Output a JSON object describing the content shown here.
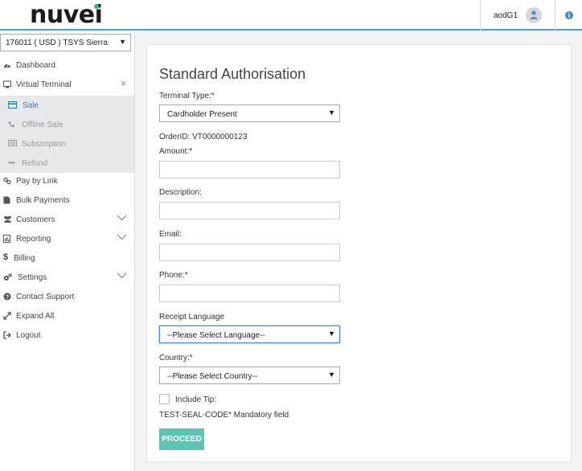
{
  "header": {
    "brand": "nuvei",
    "user_name": "aodG1"
  },
  "sidebar": {
    "merchant": "176011 ( USD ) TSYS Sierra",
    "items": [
      {
        "label": "Dashboard",
        "icon": "dashboard-icon"
      },
      {
        "label": "Virtual Terminal",
        "icon": "terminal-icon"
      },
      {
        "label": "Pay by Link",
        "icon": "link-icon"
      },
      {
        "label": "Bulk Payments",
        "icon": "document-icon"
      },
      {
        "label": "Customers",
        "icon": "users-icon"
      },
      {
        "label": "Reporting",
        "icon": "report-icon"
      },
      {
        "label": "Billing",
        "icon": "dollar-icon"
      },
      {
        "label": "Settings",
        "icon": "gears-icon"
      },
      {
        "label": "Contact Support",
        "icon": "question-icon"
      },
      {
        "label": "Expand All",
        "icon": "expand-icon"
      },
      {
        "label": "Logout",
        "icon": "logout-icon"
      }
    ],
    "subitems": [
      {
        "label": "Sale",
        "icon": "card-icon"
      },
      {
        "label": "Offline Sale",
        "icon": "phone-icon"
      },
      {
        "label": "Subscription",
        "icon": "keyboard-icon"
      },
      {
        "label": "Refund",
        "icon": "minus-icon"
      }
    ]
  },
  "form": {
    "title": "Standard Authorisation",
    "terminal_type_label": "Terminal Type:*",
    "terminal_type_value": "Cardholder Present",
    "order_id": "OrderID: VT0000000123",
    "amount_label": "Amount:*",
    "description_label": "Description:",
    "email_label": "Email:",
    "phone_label": "Phone:*",
    "receipt_language_label": "Receipt Language",
    "receipt_language_value": "--Please Select Language--",
    "country_label": "Country:*",
    "country_value": "--Please Select Country--",
    "include_tip_label": "Include Tip:",
    "seal_note": "TEST-SEAL-CODE* Mandatory field",
    "proceed_label": "PROCEED"
  },
  "colors": {
    "accent_blue": "#1f7fc5",
    "header_border": "#4a9ed8",
    "proceed_green": "#5ac6b6",
    "brand_dot": "#2bb3a5"
  }
}
